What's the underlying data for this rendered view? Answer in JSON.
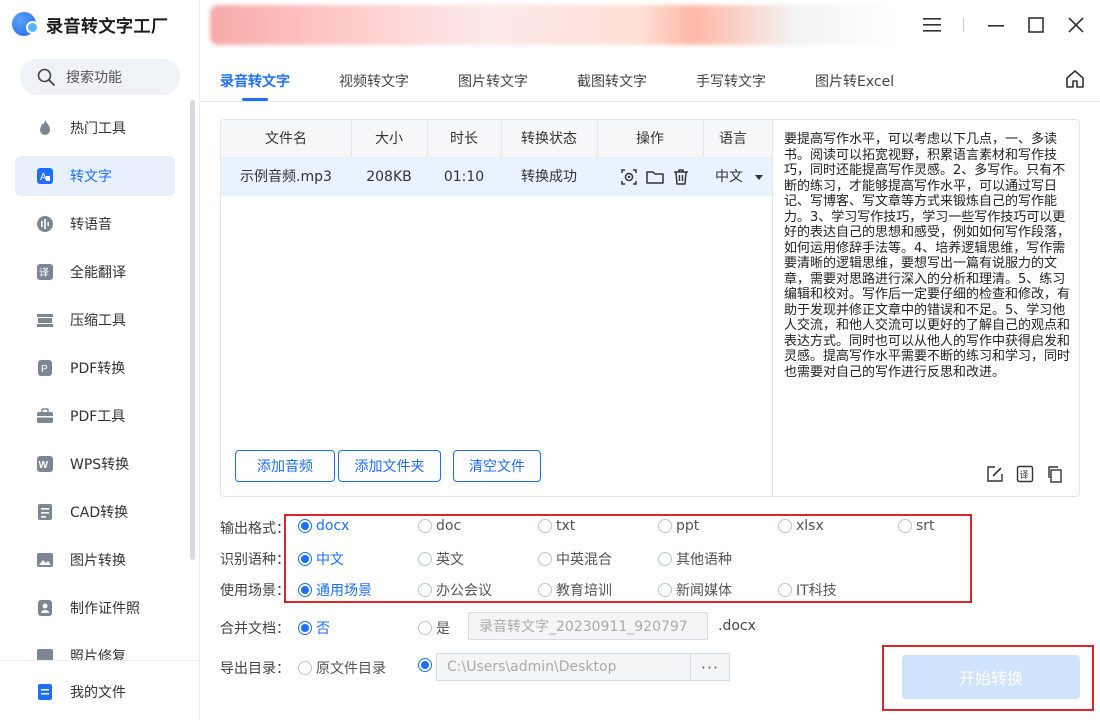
{
  "app": {
    "title": "录音转文字工厂"
  },
  "search": {
    "label": "搜索功能"
  },
  "sidebar": {
    "items": [
      {
        "label": "热门工具",
        "icon": "flame-icon"
      },
      {
        "label": "转文字",
        "icon": "text-convert-icon",
        "active": true
      },
      {
        "label": "转语音",
        "icon": "voice-icon"
      },
      {
        "label": "全能翻译",
        "icon": "translate-icon"
      },
      {
        "label": "压缩工具",
        "icon": "compress-icon"
      },
      {
        "label": "PDF转换",
        "icon": "pdf-convert-icon"
      },
      {
        "label": "PDF工具",
        "icon": "toolbox-icon"
      },
      {
        "label": "WPS转换",
        "icon": "wps-icon"
      },
      {
        "label": "CAD转换",
        "icon": "cad-icon"
      },
      {
        "label": "图片转换",
        "icon": "image-icon"
      },
      {
        "label": "制作证件照",
        "icon": "id-photo-icon"
      },
      {
        "label": "照片修复",
        "icon": "photo-repair-icon"
      }
    ],
    "bottom": {
      "label": "我的文件",
      "icon": "file-icon"
    }
  },
  "tabs": [
    {
      "label": "录音转文字",
      "active": true
    },
    {
      "label": "视频转文字"
    },
    {
      "label": "图片转文字"
    },
    {
      "label": "截图转文字"
    },
    {
      "label": "手写转文字"
    },
    {
      "label": "图片转Excel"
    }
  ],
  "table": {
    "headers": [
      "文件名",
      "大小",
      "时长",
      "转换状态",
      "操作",
      "语言"
    ],
    "rows": [
      {
        "name": "示例音频.mp3",
        "size": "208KB",
        "duration": "01:10",
        "status": "转换成功",
        "language": "中文"
      }
    ]
  },
  "actions": {
    "add_audio": "添加音频",
    "add_folder": "添加文件夹",
    "clear_files": "清空文件"
  },
  "result_text": "要提高写作水平，可以考虑以下几点，一、多读书。阅读可以拓宽视野，积累语言素材和写作技巧，同时还能提高写作灵感。2、多写作。只有不断的练习，才能够提高写作水平，可以通过写日记、写博客、写文章等方式来锻炼自己的写作能力。3、学习写作技巧，学习一些写作技巧可以更好的表达自己的思想和感受，例如如何写作段落，如何运用修辞手法等。4、培养逻辑思维，写作需要清晰的逻辑思维，要想写出一篇有说服力的文章，需要对思路进行深入的分析和理清。5、练习编辑和校对。写作后一定要仔细的检查和修改，有助于发现并修正文章中的错误和不足。5、学习他人交流，和他人交流可以更好的了解自己的观点和表达方式。同时也可以从他人的写作中获得启发和灵感。提高写作水平需要不断的练习和学习，同时也需要对自己的写作进行反思和改进。",
  "options": {
    "format": {
      "label": "输出格式：",
      "choices": [
        "docx",
        "doc",
        "txt",
        "ppt",
        "xlsx",
        "srt"
      ],
      "selected": "docx"
    },
    "language": {
      "label": "识别语种：",
      "choices": [
        "中文",
        "英文",
        "中英混合",
        "其他语种"
      ],
      "selected": "中文"
    },
    "scene": {
      "label": "使用场景：",
      "choices": [
        "通用场景",
        "办公会议",
        "教育培训",
        "新闻媒体",
        "IT科技"
      ],
      "selected": "通用场景"
    },
    "merge": {
      "label": "合并文档：",
      "no": "否",
      "yes": "是",
      "filename": "录音转文字_20230911_920797",
      "suffix": ".docx"
    },
    "export": {
      "label": "导出目录：",
      "original": "原文件目录",
      "path": "C:\\Users\\admin\\Desktop",
      "browse": "···"
    }
  },
  "start": {
    "label": "开始转换"
  },
  "colors": {
    "accent": "#1e6fff",
    "highlight_box": "#d9252c"
  }
}
